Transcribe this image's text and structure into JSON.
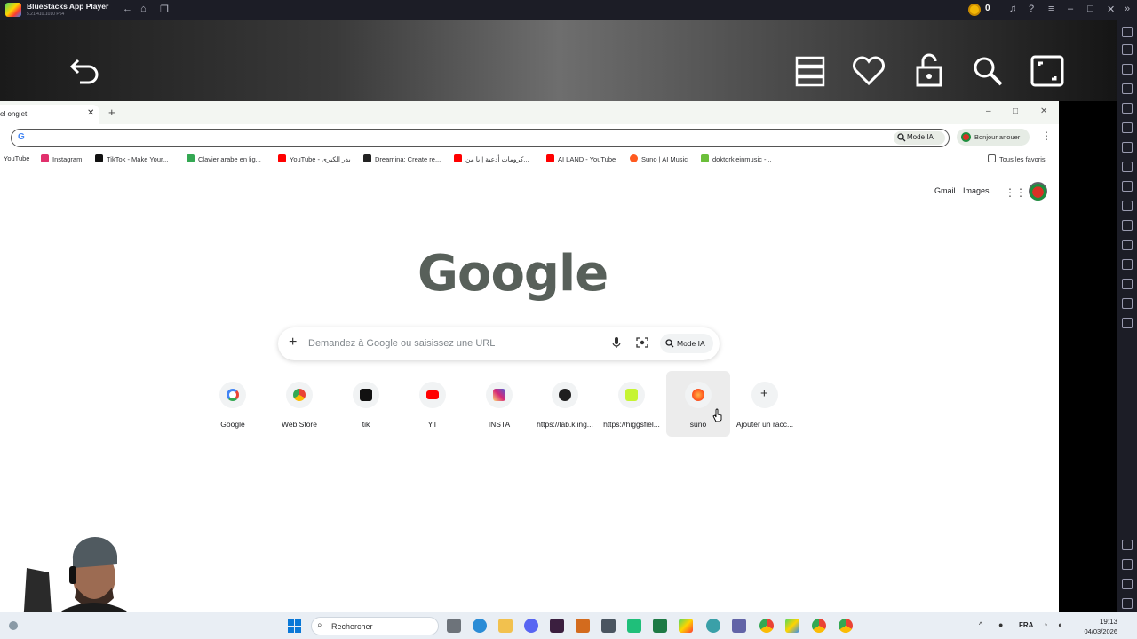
{
  "bluestacks": {
    "title": "BlueStacks App Player",
    "version": "5.21.410.1010  P64",
    "coins": "0"
  },
  "chrome": {
    "tab_title": "el onglet",
    "omnibox_mode_label": "Mode IA",
    "profile_label": "Bonjour anouer",
    "bookmarks": [
      {
        "label": "YouTube",
        "color": "#ff0000"
      },
      {
        "label": "Instagram",
        "color": "#e1306c"
      },
      {
        "label": "TikTok - Make Your...",
        "color": "#111111"
      },
      {
        "label": "Clavier arabe en lig...",
        "color": "#34a853"
      },
      {
        "label": "YouTube - بدر الكبرى",
        "color": "#ff0000"
      },
      {
        "label": "Dreamina: Create re...",
        "color": "#222222"
      },
      {
        "label": "كرومات أدعية | يا من...",
        "color": "#ff0000"
      },
      {
        "label": "AI LAND - YouTube",
        "color": "#ff0000"
      },
      {
        "label": "Suno | AI Music",
        "color": "#ff5a1f"
      },
      {
        "label": "doktorkleinmusic -...",
        "color": "#6bbf3a"
      }
    ],
    "all_bookmarks": "Tous les favoris"
  },
  "ntp": {
    "gmail": "Gmail",
    "images": "Images",
    "logo": "Google",
    "search_placeholder": "Demandez à Google ou saisissez une URL",
    "mode_label": "Mode IA",
    "shortcuts": [
      {
        "label": "Google",
        "icon": "google-icon",
        "color": "#4285f4"
      },
      {
        "label": "Web Store",
        "icon": "webstore-icon",
        "color": "#ea4335"
      },
      {
        "label": "tik",
        "icon": "tiktok-icon",
        "color": "#111111"
      },
      {
        "label": "YT",
        "icon": "youtube-icon",
        "color": "#ff0000"
      },
      {
        "label": "INSTA",
        "icon": "instagram-icon",
        "color": "#d62976"
      },
      {
        "label": "https://lab.kling...",
        "icon": "kling-icon",
        "color": "#1f1f1f"
      },
      {
        "label": "https://higgsfiel...",
        "icon": "higgsfield-icon",
        "color": "#c6f432"
      },
      {
        "label": "suno",
        "icon": "suno-icon",
        "color": "#ff5a1f"
      },
      {
        "label": "Ajouter un racc...",
        "icon": "plus-icon",
        "color": "#333333"
      }
    ]
  },
  "taskbar": {
    "search_label": "Rechercher",
    "lang": "FRA",
    "time": "19:13",
    "date": "04/03/2026"
  }
}
